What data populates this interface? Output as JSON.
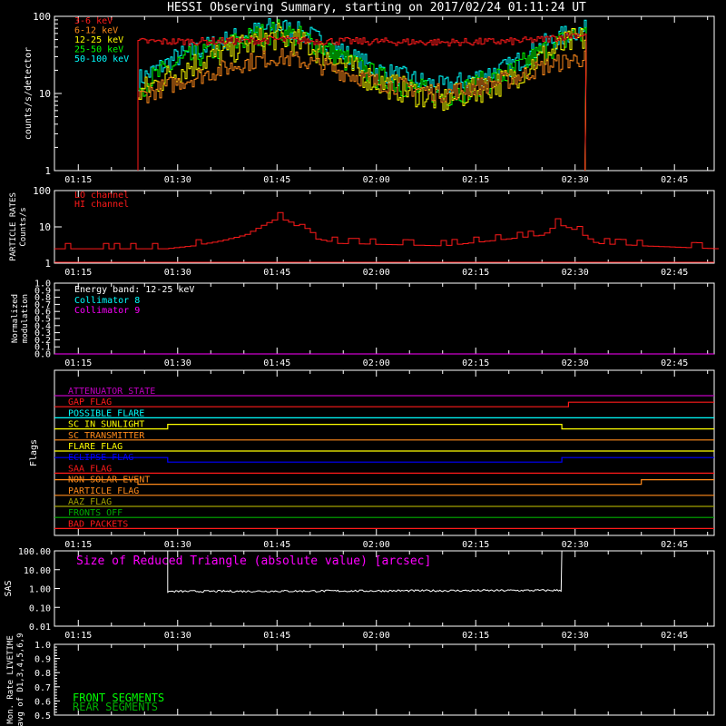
{
  "title": "HESSI Observing Summary, starting on 2017/02/24 01:11:24 UT",
  "colors": {
    "background": "#000000",
    "axis": "#ffffff",
    "red": "#ff1a1a",
    "orange": "#ff8a1a",
    "yellow": "#ffff00",
    "green": "#00ff00",
    "cyan": "#00ffff",
    "magenta": "#ff00ff",
    "white": "#ffffff",
    "blue": "#0000ff",
    "olive": "#a0a000",
    "darkgreen": "#00b000",
    "purple": "#c000c0"
  },
  "chart_data": [
    {
      "id": "count-rates",
      "type": "line",
      "ylabel": "counts/s/detector",
      "yscale": "log",
      "ylim": [
        1,
        100
      ],
      "xlim": [
        "01:11:24",
        "02:51:00"
      ],
      "x_ticks": [
        "01:15",
        "01:30",
        "01:45",
        "02:00",
        "02:15",
        "02:30",
        "02:45"
      ],
      "y_ticks": [
        "1",
        "10",
        "100"
      ],
      "data_window": [
        "01:24:00",
        "02:31:30"
      ],
      "series": [
        {
          "name": "3-6 keV",
          "color": "#ff1a1a",
          "x": [
            "01:24",
            "01:30",
            "01:40",
            "01:45",
            "01:50",
            "02:00",
            "02:10",
            "02:20",
            "02:25",
            "02:30"
          ],
          "values": [
            47,
            47,
            48,
            50,
            48,
            47,
            46,
            47,
            50,
            58
          ]
        },
        {
          "name": "6-12 keV",
          "color": "#ff8a1a",
          "x": [
            "01:24",
            "01:30",
            "01:40",
            "01:45",
            "01:50",
            "02:00",
            "02:10",
            "02:20",
            "02:25",
            "02:30"
          ],
          "values": [
            9,
            14,
            25,
            30,
            25,
            14,
            10,
            15,
            22,
            28
          ]
        },
        {
          "name": "12-25 keV",
          "color": "#ffff00",
          "x": [
            "01:24",
            "01:30",
            "01:40",
            "01:45",
            "01:50",
            "02:00",
            "02:10",
            "02:20",
            "02:25",
            "02:30"
          ],
          "values": [
            10,
            20,
            42,
            55,
            40,
            14,
            8,
            15,
            30,
            50
          ]
        },
        {
          "name": "25-50 keV",
          "color": "#00ff00",
          "x": [
            "01:24",
            "01:30",
            "01:40",
            "01:45",
            "01:50",
            "02:00",
            "02:10",
            "02:20",
            "02:25",
            "02:30"
          ],
          "values": [
            12,
            25,
            50,
            65,
            48,
            16,
            9,
            18,
            35,
            58
          ]
        },
        {
          "name": "50-100 keV",
          "color": "#00ffff",
          "x": [
            "01:24",
            "01:30",
            "01:40",
            "01:45",
            "01:50",
            "02:00",
            "02:10",
            "02:20",
            "02:25",
            "02:30"
          ],
          "values": [
            15,
            30,
            58,
            75,
            55,
            20,
            12,
            22,
            42,
            65
          ]
        }
      ]
    },
    {
      "id": "particle-rates",
      "type": "line",
      "ylabel": "PARTICLE RATES",
      "ylabel2": "Counts/s",
      "yscale": "log",
      "ylim": [
        1,
        100
      ],
      "y_ticks": [
        "1",
        "10",
        "100"
      ],
      "series": [
        {
          "name": "LO channel",
          "color": "#ff1a1a",
          "x": [
            "01:11:24",
            "01:28",
            "01:32",
            "01:36",
            "01:40",
            "01:43",
            "01:45",
            "01:47",
            "01:50",
            "01:54",
            "02:10",
            "02:25",
            "02:27",
            "02:30",
            "02:33",
            "02:40",
            "02:51"
          ],
          "values": [
            2.5,
            2.5,
            3,
            4,
            6,
            12,
            18,
            13,
            5,
            3.5,
            3,
            6,
            12,
            8,
            3.5,
            3,
            2.5
          ]
        },
        {
          "name": "HI channel",
          "color": "#ff1a1a",
          "x": [],
          "values": []
        }
      ]
    },
    {
      "id": "modulation",
      "type": "line",
      "ylabel": "Normalized",
      "ylabel2": "modulation",
      "ylim": [
        0,
        1
      ],
      "y_ticks": [
        "0.0",
        "0.1",
        "0.2",
        "0.3",
        "0.4",
        "0.5",
        "0.6",
        "0.7",
        "0.8",
        "0.9",
        "1.0"
      ],
      "annotation": "Energy band: 12-25 keV",
      "series": [
        {
          "name": "Collimator 8",
          "color": "#00ffff",
          "x": [],
          "values": []
        },
        {
          "name": "Collimator 9",
          "color": "#ff00ff",
          "x": [
            "01:11:24",
            "02:51:00"
          ],
          "values": [
            0,
            0
          ]
        }
      ]
    },
    {
      "id": "flags",
      "type": "line",
      "ylabel": "Flags",
      "series": [
        {
          "name": "ATTENUATOR STATE",
          "color": "#c000c0",
          "steps": [
            [
              "01:11:24",
              0
            ],
            [
              "02:51:00",
              0
            ]
          ]
        },
        {
          "name": "GAP FLAG",
          "color": "#ff1a1a",
          "steps": [
            [
              "01:11:24",
              0
            ],
            [
              "02:29:00",
              1
            ],
            [
              "02:51:00",
              1
            ]
          ]
        },
        {
          "name": "POSSIBLE FLARE",
          "color": "#00ffff",
          "steps": [
            [
              "01:11:24",
              0
            ],
            [
              "02:51:00",
              0
            ]
          ]
        },
        {
          "name": "SC IN SUNLIGHT",
          "color": "#ffff00",
          "steps": [
            [
              "01:11:24",
              0
            ],
            [
              "01:28:30",
              1
            ],
            [
              "02:28:00",
              0
            ],
            [
              "02:51:00",
              0
            ]
          ]
        },
        {
          "name": "SC TRANSMITTER",
          "color": "#ff8a1a",
          "steps": [
            [
              "01:11:24",
              0
            ],
            [
              "02:51:00",
              0
            ]
          ]
        },
        {
          "name": "FLARE FLAG",
          "color": "#ffff00",
          "steps": [
            [
              "01:11:24",
              0
            ],
            [
              "02:51:00",
              0
            ]
          ]
        },
        {
          "name": "ECLIPSE FLAG",
          "color": "#0000ff",
          "steps": [
            [
              "01:11:24",
              1
            ],
            [
              "01:28:30",
              0
            ],
            [
              "02:28:00",
              1
            ],
            [
              "02:51:00",
              1
            ]
          ]
        },
        {
          "name": "SAA FLAG",
          "color": "#ff1a1a",
          "steps": [
            [
              "01:11:24",
              0
            ],
            [
              "02:51:00",
              0
            ]
          ]
        },
        {
          "name": "NON SOLAR EVENT",
          "color": "#ff8a1a",
          "steps": [
            [
              "01:11:24",
              1
            ],
            [
              "01:24:00",
              0
            ],
            [
              "02:40:00",
              1
            ],
            [
              "02:51:00",
              1
            ]
          ]
        },
        {
          "name": "PARTICLE FLAG",
          "color": "#ff8a1a",
          "steps": [
            [
              "01:11:24",
              0
            ],
            [
              "02:51:00",
              0
            ]
          ]
        },
        {
          "name": "AAZ FLAG",
          "color": "#a0a000",
          "steps": [
            [
              "01:11:24",
              0
            ],
            [
              "02:51:00",
              0
            ]
          ]
        },
        {
          "name": "FRONTS OFF",
          "color": "#00b000",
          "steps": [
            [
              "01:11:24",
              0
            ],
            [
              "02:51:00",
              0
            ]
          ]
        },
        {
          "name": "BAD PACKETS",
          "color": "#ff1a1a",
          "steps": [
            [
              "01:11:24",
              0
            ],
            [
              "02:51:00",
              0
            ]
          ]
        }
      ]
    },
    {
      "id": "sas",
      "type": "line",
      "ylabel": "SAS",
      "yscale": "log",
      "ylim": [
        0.01,
        100
      ],
      "y_ticks": [
        "100.00",
        "10.00",
        "1.00",
        "0.10",
        "0.01"
      ],
      "annotation": "Size of Reduced Triangle (absolute value) [arcsec]",
      "series": [
        {
          "name": "Size of Reduced Triangle (absolute value) [arcsec]",
          "color": "#ffffff",
          "x": [
            "01:28:30",
            "02:28:00"
          ],
          "values": [
            0.7,
            0.8
          ]
        }
      ]
    },
    {
      "id": "livetime",
      "type": "line",
      "ylabel": "Mon. Rate LIVETIME",
      "ylabel2": "avg of D1,3,4,5,6,9",
      "ylim": [
        0.5,
        1.0
      ],
      "y_ticks": [
        "0.5",
        "0.6",
        "0.7",
        "0.8",
        "0.9",
        "1.0"
      ],
      "series": [
        {
          "name": "FRONT SEGMENTS",
          "color": "#00ff00",
          "x": [],
          "values": []
        },
        {
          "name": "REAR SEGMENTS",
          "color": "#00b000",
          "x": [],
          "values": []
        }
      ]
    }
  ]
}
